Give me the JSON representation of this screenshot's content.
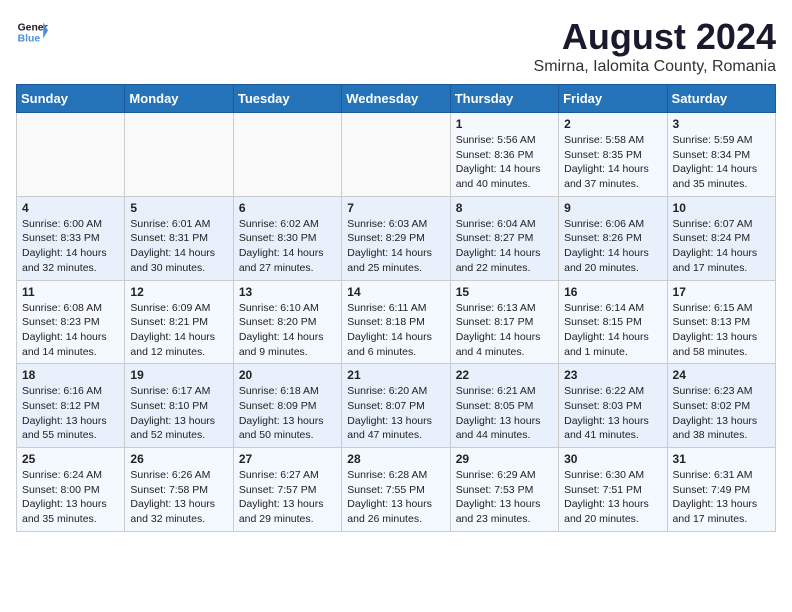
{
  "header": {
    "logo_line1": "General",
    "logo_line2": "Blue",
    "month_year": "August 2024",
    "location": "Smirna, Ialomita County, Romania"
  },
  "weekdays": [
    "Sunday",
    "Monday",
    "Tuesday",
    "Wednesday",
    "Thursday",
    "Friday",
    "Saturday"
  ],
  "weeks": [
    [
      {
        "day": "",
        "content": ""
      },
      {
        "day": "",
        "content": ""
      },
      {
        "day": "",
        "content": ""
      },
      {
        "day": "",
        "content": ""
      },
      {
        "day": "1",
        "content": "Sunrise: 5:56 AM\nSunset: 8:36 PM\nDaylight: 14 hours and 40 minutes."
      },
      {
        "day": "2",
        "content": "Sunrise: 5:58 AM\nSunset: 8:35 PM\nDaylight: 14 hours and 37 minutes."
      },
      {
        "day": "3",
        "content": "Sunrise: 5:59 AM\nSunset: 8:34 PM\nDaylight: 14 hours and 35 minutes."
      }
    ],
    [
      {
        "day": "4",
        "content": "Sunrise: 6:00 AM\nSunset: 8:33 PM\nDaylight: 14 hours and 32 minutes."
      },
      {
        "day": "5",
        "content": "Sunrise: 6:01 AM\nSunset: 8:31 PM\nDaylight: 14 hours and 30 minutes."
      },
      {
        "day": "6",
        "content": "Sunrise: 6:02 AM\nSunset: 8:30 PM\nDaylight: 14 hours and 27 minutes."
      },
      {
        "day": "7",
        "content": "Sunrise: 6:03 AM\nSunset: 8:29 PM\nDaylight: 14 hours and 25 minutes."
      },
      {
        "day": "8",
        "content": "Sunrise: 6:04 AM\nSunset: 8:27 PM\nDaylight: 14 hours and 22 minutes."
      },
      {
        "day": "9",
        "content": "Sunrise: 6:06 AM\nSunset: 8:26 PM\nDaylight: 14 hours and 20 minutes."
      },
      {
        "day": "10",
        "content": "Sunrise: 6:07 AM\nSunset: 8:24 PM\nDaylight: 14 hours and 17 minutes."
      }
    ],
    [
      {
        "day": "11",
        "content": "Sunrise: 6:08 AM\nSunset: 8:23 PM\nDaylight: 14 hours and 14 minutes."
      },
      {
        "day": "12",
        "content": "Sunrise: 6:09 AM\nSunset: 8:21 PM\nDaylight: 14 hours and 12 minutes."
      },
      {
        "day": "13",
        "content": "Sunrise: 6:10 AM\nSunset: 8:20 PM\nDaylight: 14 hours and 9 minutes."
      },
      {
        "day": "14",
        "content": "Sunrise: 6:11 AM\nSunset: 8:18 PM\nDaylight: 14 hours and 6 minutes."
      },
      {
        "day": "15",
        "content": "Sunrise: 6:13 AM\nSunset: 8:17 PM\nDaylight: 14 hours and 4 minutes."
      },
      {
        "day": "16",
        "content": "Sunrise: 6:14 AM\nSunset: 8:15 PM\nDaylight: 14 hours and 1 minute."
      },
      {
        "day": "17",
        "content": "Sunrise: 6:15 AM\nSunset: 8:13 PM\nDaylight: 13 hours and 58 minutes."
      }
    ],
    [
      {
        "day": "18",
        "content": "Sunrise: 6:16 AM\nSunset: 8:12 PM\nDaylight: 13 hours and 55 minutes."
      },
      {
        "day": "19",
        "content": "Sunrise: 6:17 AM\nSunset: 8:10 PM\nDaylight: 13 hours and 52 minutes."
      },
      {
        "day": "20",
        "content": "Sunrise: 6:18 AM\nSunset: 8:09 PM\nDaylight: 13 hours and 50 minutes."
      },
      {
        "day": "21",
        "content": "Sunrise: 6:20 AM\nSunset: 8:07 PM\nDaylight: 13 hours and 47 minutes."
      },
      {
        "day": "22",
        "content": "Sunrise: 6:21 AM\nSunset: 8:05 PM\nDaylight: 13 hours and 44 minutes."
      },
      {
        "day": "23",
        "content": "Sunrise: 6:22 AM\nSunset: 8:03 PM\nDaylight: 13 hours and 41 minutes."
      },
      {
        "day": "24",
        "content": "Sunrise: 6:23 AM\nSunset: 8:02 PM\nDaylight: 13 hours and 38 minutes."
      }
    ],
    [
      {
        "day": "25",
        "content": "Sunrise: 6:24 AM\nSunset: 8:00 PM\nDaylight: 13 hours and 35 minutes."
      },
      {
        "day": "26",
        "content": "Sunrise: 6:26 AM\nSunset: 7:58 PM\nDaylight: 13 hours and 32 minutes."
      },
      {
        "day": "27",
        "content": "Sunrise: 6:27 AM\nSunset: 7:57 PM\nDaylight: 13 hours and 29 minutes."
      },
      {
        "day": "28",
        "content": "Sunrise: 6:28 AM\nSunset: 7:55 PM\nDaylight: 13 hours and 26 minutes."
      },
      {
        "day": "29",
        "content": "Sunrise: 6:29 AM\nSunset: 7:53 PM\nDaylight: 13 hours and 23 minutes."
      },
      {
        "day": "30",
        "content": "Sunrise: 6:30 AM\nSunset: 7:51 PM\nDaylight: 13 hours and 20 minutes."
      },
      {
        "day": "31",
        "content": "Sunrise: 6:31 AM\nSunset: 7:49 PM\nDaylight: 13 hours and 17 minutes."
      }
    ]
  ]
}
